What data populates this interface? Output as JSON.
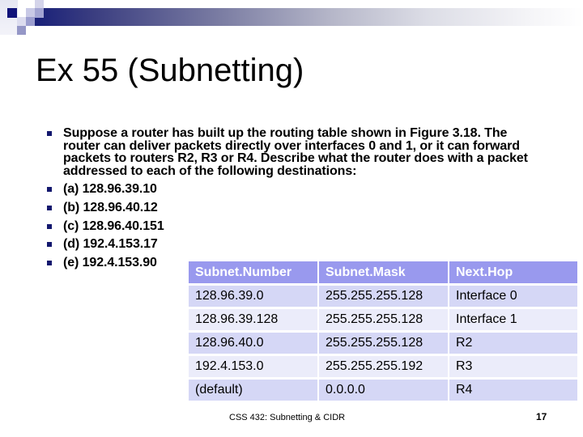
{
  "slide": {
    "title": "Ex 55 (Subnetting)",
    "bullets": [
      "Suppose a router has built up the routing table shown in Figure 3.18. The router can deliver packets directly over interfaces 0 and 1, or it can forward packets to routers R2, R3 or R4. Describe what the router does with a packet addressed to each of the following destinations:",
      "(a) 128.96.39.10",
      "(b) 128.96.40.12",
      "(c) 128.96.40.151",
      "(d) 192.4.153.17",
      "(e) 192.4.153.90"
    ],
    "table": {
      "headers": [
        "Subnet.Number",
        "Subnet.Mask",
        "Next.Hop"
      ],
      "rows": [
        [
          "128.96.39.0",
          "255.255.255.128",
          "Interface 0"
        ],
        [
          "128.96.39.128",
          "255.255.255.128",
          "Interface 1"
        ],
        [
          "128.96.40.0",
          "255.255.255.128",
          "R2"
        ],
        [
          "192.4.153.0",
          "255.255.255.192",
          "R3"
        ],
        [
          "(default)",
          "0.0.0.0",
          "R4"
        ]
      ]
    },
    "footer": "CSS 432: Subnetting & CIDR",
    "page_number": "17"
  },
  "colors": {
    "header_band_start": "#141c78",
    "bullet": "#13186e",
    "table_header_bg": "#9999ee",
    "table_row_odd": "#d5d7f6",
    "table_row_even": "#ebecfa"
  }
}
